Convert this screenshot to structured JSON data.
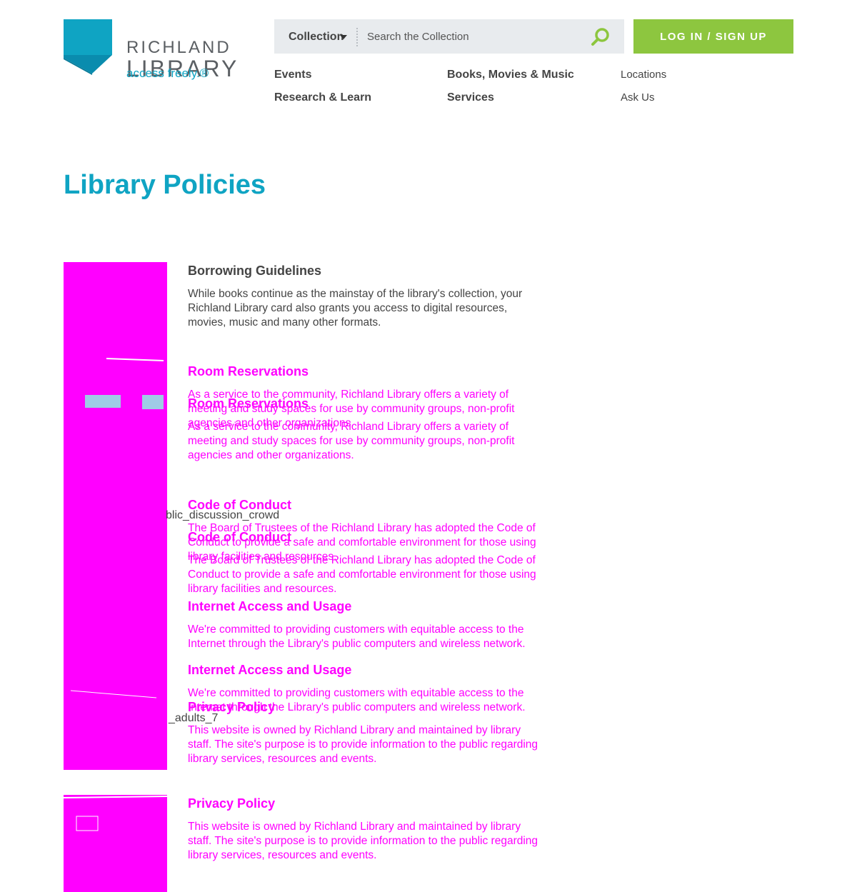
{
  "logo": {
    "word1": "RICHLAND",
    "word2": "LIBRARY",
    "tagline": "access freely.®"
  },
  "search": {
    "collection_label": "Collection",
    "placeholder": "Search the Collection"
  },
  "login_label": "LOG IN / SIGN UP",
  "nav": {
    "events": "Events",
    "books": "Books, Movies & Music",
    "locations": "Locations",
    "research": "Research & Learn",
    "services": "Services",
    "ask": "Ask Us"
  },
  "page_title": "Library Policies",
  "policies": {
    "borrowing": {
      "title": "Borrowing Guidelines",
      "text": "While books continue as the mainstay of the library's collection, your Richland Library card also grants you access to digital resources, movies, music and many other formats."
    },
    "rooms": {
      "title": "Room Reservations",
      "text": "As a service to the community, Richland Library offers a variety of meeting and study spaces for use by community groups, non-profit agencies and other organizations."
    },
    "conduct": {
      "title": "Code of Conduct",
      "text": "The Board of Trustees of the Richland Library has adopted the Code of Conduct to provide a safe and comfortable environment for those using library facilities and resources."
    },
    "internet": {
      "title": "Internet Access and Usage",
      "text": "We're committed to providing customers with equitable access to the Internet through the Library's public computers and wireless network."
    },
    "privacy": {
      "title": "Privacy Policy",
      "text": "This website is owned by Richland Library and maintained by library staff. The site's purpose is to provide information to the public regarding library services, resources and events."
    }
  },
  "image_captions": {
    "crowd": "blic_discussion_crowd",
    "adults": "_adults_7"
  },
  "colors": {
    "brand_teal": "#0fa4c3",
    "login_green": "#8dc63f",
    "placeholder_magenta": "#ff00ff"
  }
}
